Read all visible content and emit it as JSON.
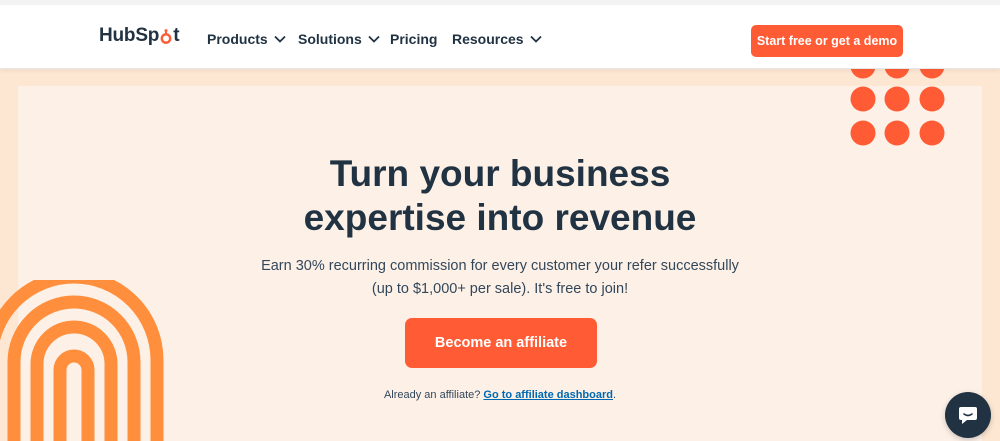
{
  "brand": {
    "logo_text_left": "HubSp",
    "logo_text_right": "t",
    "accent_color": "#ff5c35",
    "dark_color": "#213343",
    "link_color": "#0068b1"
  },
  "nav": {
    "items": [
      {
        "label": "Products",
        "has_dropdown": true
      },
      {
        "label": "Solutions",
        "has_dropdown": true
      },
      {
        "label": "Pricing",
        "has_dropdown": false
      },
      {
        "label": "Resources",
        "has_dropdown": true
      }
    ],
    "cta_label": "Start free or get a demo"
  },
  "hero": {
    "headline_line1": "Turn your business",
    "headline_line2": "expertise into revenue",
    "subtext_line1": "Earn 30% recurring commission for every customer your refer successfully",
    "subtext_line2": "(up to $1,000+ per sale). It's free to join!",
    "cta_label": "Become an affiliate",
    "already_text": "Already an affiliate?",
    "dashboard_link": "Go to affiliate dashboard",
    "trailing_period": "."
  },
  "icons": {
    "chat": "chat-bubble-icon",
    "chevron": "chevron-down-icon",
    "logo_mark": "sprocket-icon"
  }
}
